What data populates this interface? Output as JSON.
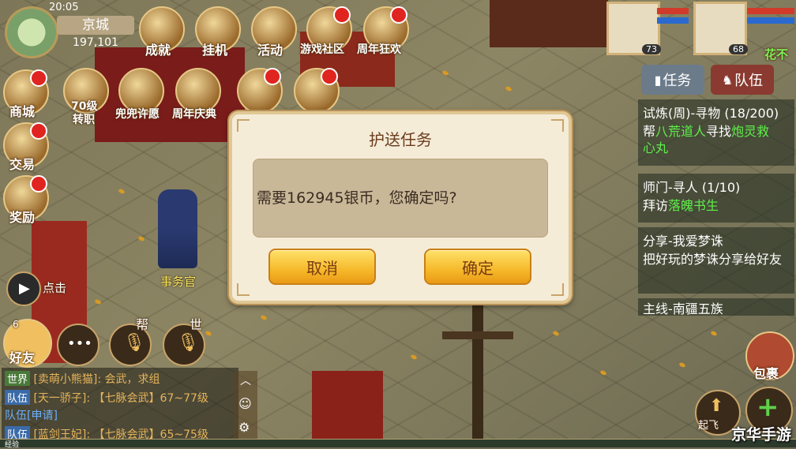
{
  "status": {
    "time": "20:05",
    "city": "京城",
    "coords": "197,101"
  },
  "top_menu": [
    {
      "label": "成就",
      "icon": "achievement-icon"
    },
    {
      "label": "挂机",
      "icon": "auto-battle-icon"
    },
    {
      "label": "活动",
      "icon": "event-icon"
    },
    {
      "label": "游戏社区",
      "icon": "community-icon"
    },
    {
      "label": "周年狂欢",
      "icon": "anniversary-carnival-icon"
    }
  ],
  "second_menu": [
    {
      "label": "70级",
      "sub": "转职"
    },
    {
      "label": "兜兜许愿"
    },
    {
      "label": "周年庆典"
    }
  ],
  "left_menu": [
    {
      "label": "商城",
      "icon": "shop-icon"
    },
    {
      "label": "交易",
      "icon": "trade-icon"
    },
    {
      "label": "奖励",
      "icon": "reward-icon"
    }
  ],
  "party": [
    {
      "level": "73"
    },
    {
      "level": "68"
    }
  ],
  "party_note": "花不",
  "tabs": {
    "task": "任务",
    "team": "队伍"
  },
  "quests": [
    {
      "title": "试炼(周)-寻物 (18/200)",
      "desc": [
        "帮",
        "八荒道人",
        "寻找",
        "炮灵救",
        "心丸"
      ]
    },
    {
      "title": "师门-寻人 (1/10)",
      "desc": [
        "拜访",
        "落魄书生"
      ]
    },
    {
      "title": "分享-我爱梦诛",
      "desc": [
        "把好玩的梦诛分享给好友"
      ]
    },
    {
      "title": "主线-南疆五族"
    }
  ],
  "npc": {
    "name": "事务官"
  },
  "dialog": {
    "title": "护送任务",
    "message": "需要162945银币，您确定吗?",
    "cancel": "取消",
    "confirm": "确定"
  },
  "left_controls": {
    "click_label": "点击",
    "friend": "好友",
    "friend_count": "6",
    "voice_help": "帮",
    "voice_world": "世"
  },
  "chat": [
    {
      "channel": "世界",
      "channel_color": "#4a7a3a",
      "text": "[卖萌小熊猫]: 会武，求组"
    },
    {
      "channel": "队伍",
      "channel_color": "#3a6aa8",
      "text": "[天一骄子]: 【七脉会武】67~77级",
      "tail": "队伍[申请]"
    },
    {
      "channel": "队伍",
      "channel_color": "#3a6aa8",
      "text": "[蓝剑王妃]: 【七脉会武】65~75级"
    }
  ],
  "bottom_label": "经验",
  "right_controls": {
    "bag": "包裹",
    "gather": "起飞"
  },
  "watermark": "京华手游"
}
